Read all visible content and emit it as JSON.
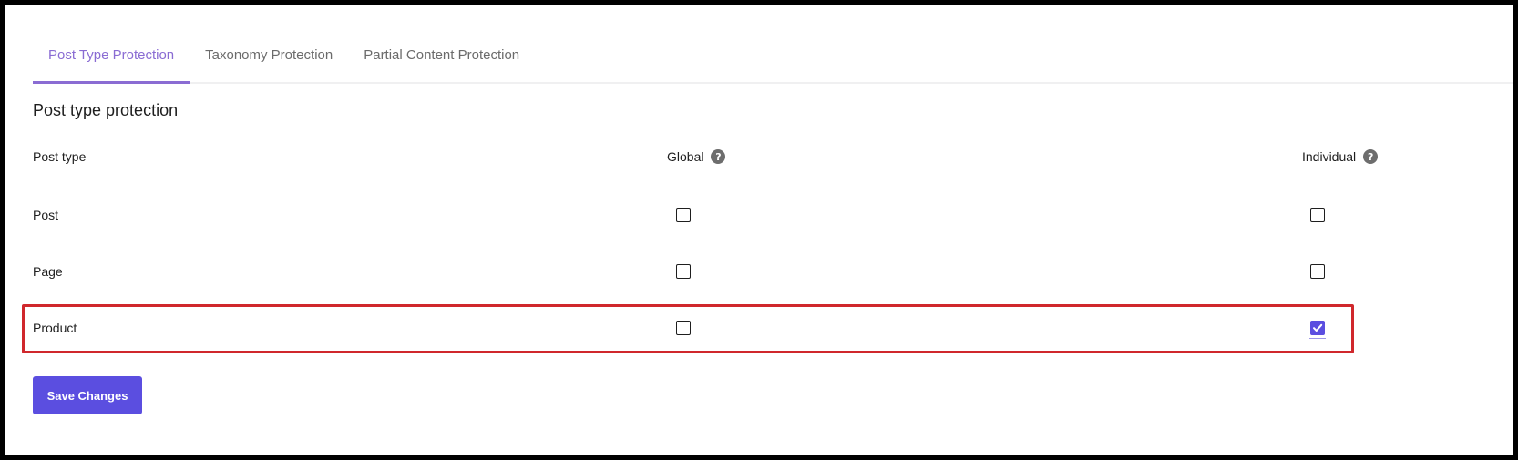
{
  "tabs": [
    {
      "label": "Post Type Protection",
      "active": true
    },
    {
      "label": "Taxonomy Protection",
      "active": false
    },
    {
      "label": "Partial Content Protection",
      "active": false
    }
  ],
  "section": {
    "title": "Post type protection"
  },
  "table": {
    "headers": {
      "post_type": "Post type",
      "global": "Global",
      "individual": "Individual",
      "help_glyph": "?"
    },
    "rows": [
      {
        "label": "Post",
        "global": false,
        "individual": false
      },
      {
        "label": "Page",
        "global": false,
        "individual": false
      },
      {
        "label": "Product",
        "global": false,
        "individual": true,
        "highlighted": true
      }
    ]
  },
  "actions": {
    "save_label": "Save Changes"
  },
  "colors": {
    "accent": "#5b4ee0",
    "active_tab": "#8a6cd3",
    "highlight": "#d0282c"
  }
}
